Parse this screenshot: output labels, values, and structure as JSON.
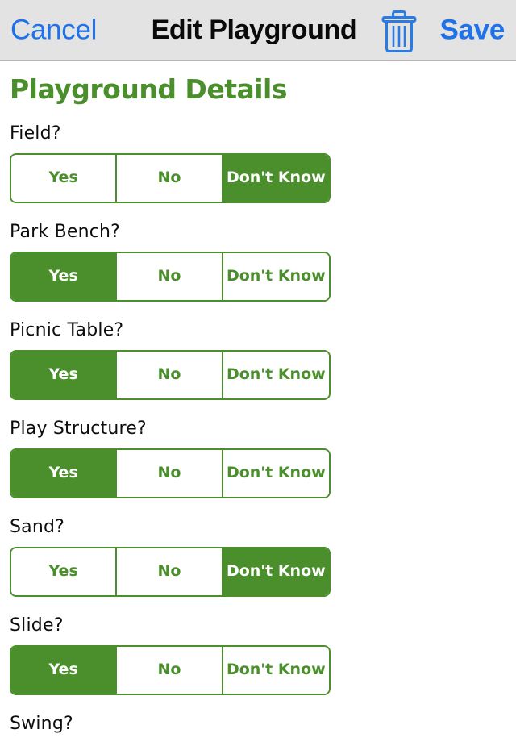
{
  "navbar": {
    "cancel_label": "Cancel",
    "title": "Edit Playground",
    "delete_icon": "trash-icon",
    "save_label": "Save",
    "tint_color": "#1f72e8",
    "background_color": "#e3e3e3"
  },
  "content": {
    "section_heading": "Playground Details",
    "accent_color": "#4a8f2c",
    "options": [
      "Yes",
      "No",
      "Don't Know"
    ],
    "fields": [
      {
        "label": "Field?",
        "selected": "Don't Know"
      },
      {
        "label": "Park Bench?",
        "selected": "Yes"
      },
      {
        "label": "Picnic Table?",
        "selected": "Yes"
      },
      {
        "label": "Play Structure?",
        "selected": "Yes"
      },
      {
        "label": "Sand?",
        "selected": "Don't Know"
      },
      {
        "label": "Slide?",
        "selected": "Yes"
      },
      {
        "label": "Swing?",
        "selected": ""
      }
    ]
  }
}
